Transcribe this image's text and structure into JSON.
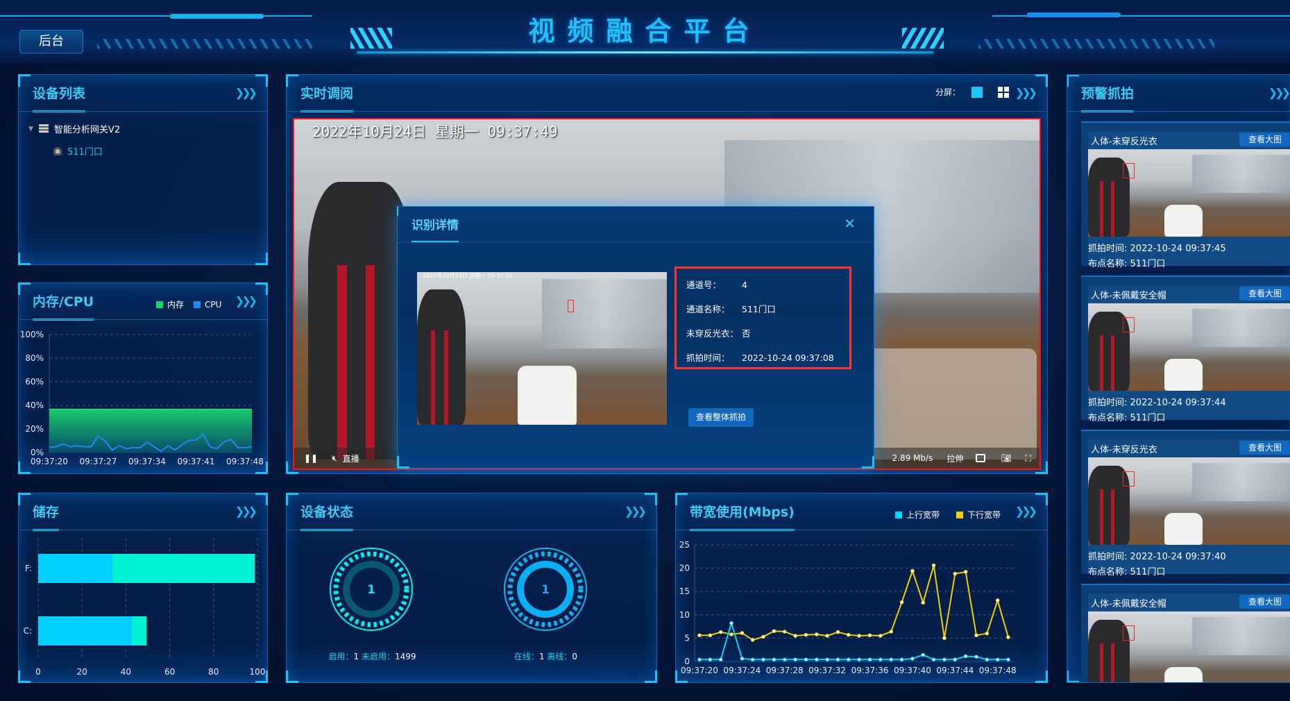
{
  "header": {
    "title": "视频融合平台",
    "back_label": "后台"
  },
  "device_list": {
    "title": "设备列表",
    "tree": {
      "root": "智能分析网关V2",
      "children": [
        "511门口"
      ]
    }
  },
  "mem_cpu": {
    "title": "内存/CPU"
  },
  "storage": {
    "title": "储存"
  },
  "live": {
    "title": "实时调阅",
    "split_label": "分屏：",
    "osd_text": "2022年10月24日  星期一  09:37:49",
    "controls": {
      "live_label": "直播",
      "bitrate": "2.89 Mb/s",
      "stretch_label": "拉伸"
    }
  },
  "dialog": {
    "title": "识别详情",
    "fields": [
      {
        "label": "通道号：",
        "value": "4"
      },
      {
        "label": "通道名称：",
        "value": "511门口"
      },
      {
        "label": "未穿反光衣：",
        "value": "否"
      },
      {
        "label": "抓拍时间：",
        "value": "2022-10-24 09:37:08"
      }
    ],
    "thumb_osd": "2022年10月24日 星期一 09:37:05",
    "view_all_label": "查看整体抓拍"
  },
  "device_status": {
    "title": "设备状态",
    "gauges": [
      {
        "value": "1",
        "caption_a": "启用：",
        "val_a": "1",
        "caption_b": " 未启用：",
        "val_b": "1499",
        "color": "#00f0f0"
      },
      {
        "value": "1",
        "caption_a": "在线：",
        "val_a": "1",
        "caption_b": " 离线：",
        "val_b": "0",
        "color": "#0fb4f0"
      }
    ]
  },
  "alerts": {
    "title": "预警抓拍",
    "view_label": "查看大图",
    "time_label": "抓拍时间:",
    "site_label": "布点名称:",
    "items": [
      {
        "title": "人体-未穿反光衣",
        "time": "2022-10-24 09:37:45",
        "site": "511门口"
      },
      {
        "title": "人体-未佩戴安全帽",
        "time": "2022-10-24 09:37:44",
        "site": "511门口"
      },
      {
        "title": "人体-未穿反光衣",
        "time": "2022-10-24 09:37:40",
        "site": "511门口"
      },
      {
        "title": "人体-未佩戴安全帽",
        "time": "",
        "site": ""
      }
    ]
  },
  "chart_data": [
    {
      "type": "area",
      "title": "内存/CPU",
      "series": [
        {
          "name": "内存",
          "color": "#19d66b",
          "values": [
            36.5,
            36.5,
            36.5,
            36.5,
            36.5,
            36.5,
            36.5,
            36.5,
            36.5,
            36.5,
            36.5,
            36.5,
            36.5,
            36.5,
            36.5,
            36.5,
            36.5,
            36.5,
            36.5,
            36.5,
            36.5,
            36.5,
            36.5,
            36.5,
            36.5,
            36.5,
            36.5,
            36.5,
            36.5,
            36.5
          ]
        },
        {
          "name": "CPU",
          "color": "#1e88f5",
          "values": [
            4.3,
            5,
            7.4,
            5,
            5.7,
            5,
            5,
            14.3,
            9.8,
            2,
            5.9,
            3.3,
            4.1,
            4.1,
            8.8,
            5,
            1,
            5.7,
            2.2,
            6.5,
            10.2,
            10.8,
            15.7,
            5,
            3.3,
            9,
            11.2,
            4.1,
            4.1,
            5
          ]
        }
      ],
      "x_start": "09:37:20",
      "x_ticks": [
        "09:37:20",
        "09:37:27",
        "09:37:34",
        "09:37:41",
        "09:37:48"
      ],
      "y_ticks": [
        "0%",
        "20%",
        "40%",
        "60%",
        "80%",
        "100%"
      ],
      "ylim": [
        0,
        100
      ],
      "grid": true,
      "legend": "top-right"
    },
    {
      "type": "bar",
      "orientation": "horizontal",
      "stacked": true,
      "title": "储存",
      "categories": [
        "F:",
        "C:"
      ],
      "series": [
        {
          "color": "#00cfff",
          "values": [
            33.8,
            42.7
          ]
        },
        {
          "color": "#00f2d4",
          "values": [
            65,
            6.8
          ]
        }
      ],
      "x_ticks": [
        "0",
        "20",
        "40",
        "60",
        "80",
        "100"
      ],
      "xlim": [
        0,
        100
      ],
      "grid": true
    },
    {
      "type": "line",
      "title": "带宽使用(Mbps)",
      "x_ticks": [
        "09:37:20",
        "09:37:24",
        "09:37:28",
        "09:37:32",
        "09:37:36",
        "09:37:40",
        "09:37:44",
        "09:37:48"
      ],
      "y_ticks": [
        "0",
        "5",
        "10",
        "15",
        "20",
        "25"
      ],
      "ylim": [
        0,
        25
      ],
      "grid": true,
      "legend": "top-right",
      "series": [
        {
          "name": "上行宽带",
          "color": "#00d8ff",
          "values": [
            0.4,
            0.4,
            0.4,
            8.2,
            0.6,
            0.4,
            0.4,
            0.4,
            0.4,
            0.4,
            0.4,
            0.4,
            0.4,
            0.4,
            0.4,
            0.4,
            0.4,
            0.4,
            0.4,
            0.4,
            0.6,
            1.4,
            0.4,
            0.4,
            0.4,
            1.1,
            1.0,
            0.4,
            0.4,
            0.4
          ]
        },
        {
          "name": "下行宽带",
          "color": "#f2cf00",
          "values": [
            5.6,
            5.6,
            6.3,
            5.8,
            6.1,
            4.6,
            5.3,
            6.5,
            6.4,
            5.5,
            5.7,
            5.8,
            5.5,
            6.3,
            5.7,
            5.5,
            5.6,
            5.5,
            6.4,
            12.7,
            19.4,
            12.6,
            20.6,
            5.0,
            18.8,
            19.2,
            5.6,
            6.0,
            13.1,
            5.2
          ]
        }
      ]
    }
  ]
}
